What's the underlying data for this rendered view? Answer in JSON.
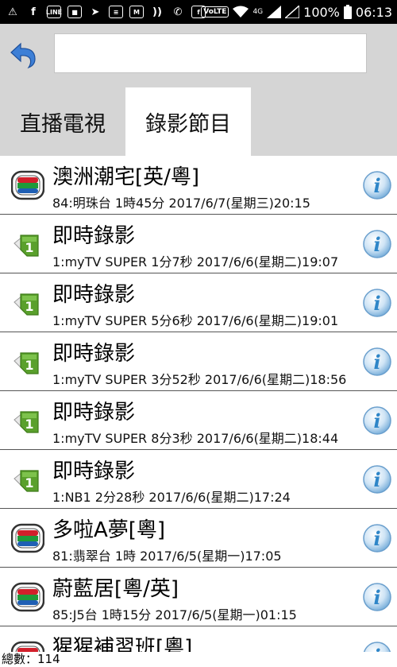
{
  "status_bar": {
    "battery": "100%",
    "time": "06:13",
    "volte": "VoLTE",
    "network": "4G",
    "left_icons": [
      "warning-icon",
      "facebook-icon",
      "line-icon",
      "app-icon",
      "telegram-icon",
      "message-icon",
      "gmail-icon",
      "nfc-icon",
      "phone-app-icon",
      "facebook-icon"
    ]
  },
  "toolbar": {
    "search_value": ""
  },
  "tabs": {
    "live": "直播電視",
    "recorded": "錄影節目"
  },
  "recordings": [
    {
      "title": "澳洲潮宅[英/粵]",
      "detail": "84:明珠台 1時45分 2017/6/7(星期三)20:15",
      "icon": "tvb-logo-icon"
    },
    {
      "title": "即時錄影",
      "detail": "1:myTV SUPER 1分7秒 2017/6/6(星期二)19:07",
      "icon": "instant-record-icon"
    },
    {
      "title": "即時錄影",
      "detail": "1:myTV SUPER 5分6秒 2017/6/6(星期二)19:01",
      "icon": "instant-record-icon"
    },
    {
      "title": "即時錄影",
      "detail": "1:myTV SUPER 3分52秒 2017/6/6(星期二)18:56",
      "icon": "instant-record-icon"
    },
    {
      "title": "即時錄影",
      "detail": "1:myTV SUPER 8分3秒 2017/6/6(星期二)18:44",
      "icon": "instant-record-icon"
    },
    {
      "title": "即時錄影",
      "detail": "1:NB1 2分28秒 2017/6/6(星期二)17:24",
      "icon": "instant-record-icon"
    },
    {
      "title": "多啦A夢[粵]",
      "detail": "81:翡翠台 1時 2017/6/5(星期一)17:05",
      "icon": "tvb-logo-icon"
    },
    {
      "title": "蔚藍居[粵/英]",
      "detail": "85:J5台 1時15分 2017/6/5(星期一)01:15",
      "icon": "tvb-logo-icon"
    },
    {
      "title": "猩猩補習班[粵]",
      "detail": "",
      "icon": "tvb-logo-icon"
    }
  ],
  "footer": {
    "count_text": "總數：114"
  },
  "colors": {
    "tab_bar": "#d5d5d5",
    "info_blue": "#2f86c8",
    "record_green": "#5aa02c",
    "tvb_red": "#d21f2b",
    "tvb_green": "#1f9a3a",
    "tvb_blue": "#1f5fb4"
  }
}
